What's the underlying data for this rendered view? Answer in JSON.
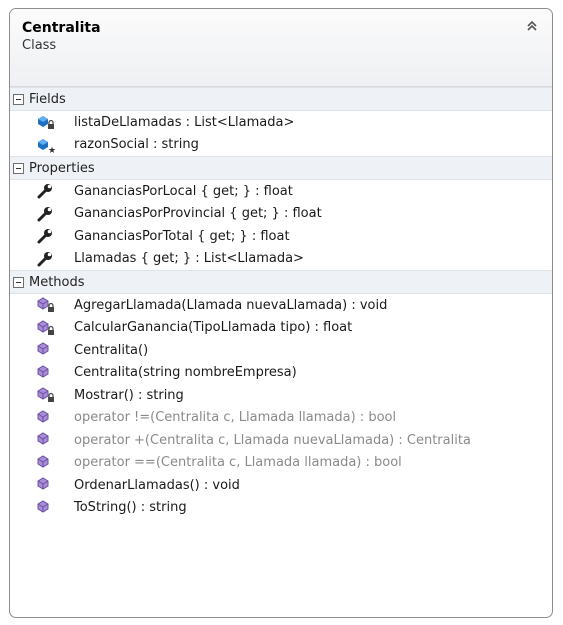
{
  "class_box": {
    "title": "Centralita",
    "subtitle": "Class",
    "collapse_icon": "double-chevron-up-icon"
  },
  "sections": {
    "fields": {
      "label": "Fields",
      "items": [
        {
          "text": "listaDeLlamadas : List<Llamada>",
          "icon": "private-field-icon",
          "dim": false
        },
        {
          "text": "razonSocial : string",
          "icon": "static-field-icon",
          "dim": false
        }
      ]
    },
    "properties": {
      "label": "Properties",
      "items": [
        {
          "text": "GananciasPorLocal { get; } : float",
          "icon": "wrench-property-icon",
          "dim": false
        },
        {
          "text": "GananciasPorProvincial { get; } : float",
          "icon": "wrench-property-icon",
          "dim": false
        },
        {
          "text": "GananciasPorTotal { get; } : float",
          "icon": "wrench-property-icon",
          "dim": false
        },
        {
          "text": "Llamadas { get; } : List<Llamada>",
          "icon": "wrench-property-icon",
          "dim": false
        }
      ]
    },
    "methods": {
      "label": "Methods",
      "items": [
        {
          "text": "AgregarLlamada(Llamada nuevaLlamada) : void",
          "icon": "private-method-icon",
          "dim": false
        },
        {
          "text": "CalcularGanancia(TipoLlamada tipo) : float",
          "icon": "private-method-icon",
          "dim": false
        },
        {
          "text": "Centralita()",
          "icon": "method-icon",
          "dim": false
        },
        {
          "text": "Centralita(string nombreEmpresa)",
          "icon": "method-icon",
          "dim": false
        },
        {
          "text": "Mostrar() : string",
          "icon": "private-method-icon",
          "dim": false
        },
        {
          "text": "operator !=(Centralita c, Llamada llamada) : bool",
          "icon": "method-icon",
          "dim": true
        },
        {
          "text": "operator +(Centralita c, Llamada nuevaLlamada) : Centralita",
          "icon": "method-icon",
          "dim": true
        },
        {
          "text": "operator ==(Centralita c, Llamada llamada) : bool",
          "icon": "method-icon",
          "dim": true
        },
        {
          "text": "OrdenarLlamadas() : void",
          "icon": "method-icon",
          "dim": false
        },
        {
          "text": "ToString() : string",
          "icon": "method-icon",
          "dim": false
        }
      ]
    }
  }
}
